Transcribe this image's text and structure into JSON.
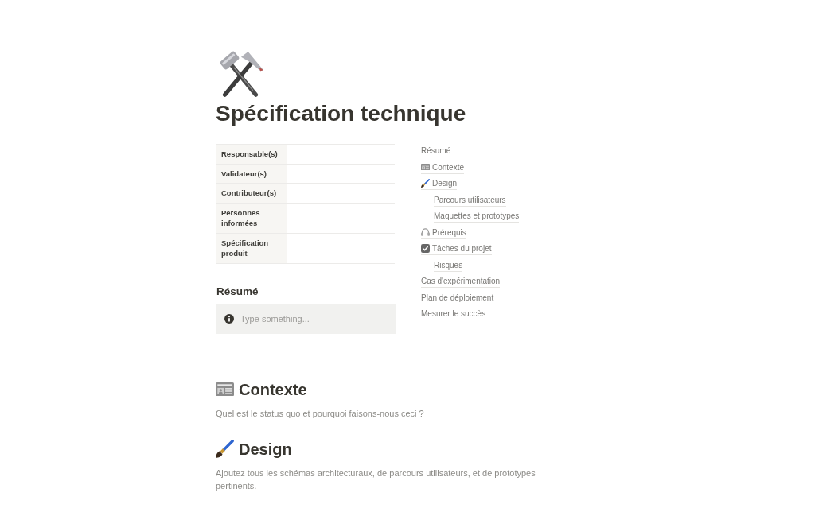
{
  "page": {
    "title": "Spécification technique"
  },
  "properties": [
    {
      "label": "Responsable(s)"
    },
    {
      "label": "Validateur(s)"
    },
    {
      "label": "Contributeur(s)"
    },
    {
      "label": "Personnes informées"
    },
    {
      "label": "Spécification produit"
    }
  ],
  "summary": {
    "heading": "Résumé",
    "callout": {
      "placeholder": "Type something..."
    }
  },
  "table_of_contents": [
    {
      "label": "Résumé"
    },
    {
      "label": "Contexte",
      "kind": "newspaper"
    },
    {
      "label": "Design",
      "kind": "brush",
      "children": [
        {
          "label": "Parcours utilisateurs"
        },
        {
          "label": "Maquettes et prototypes"
        }
      ]
    },
    {
      "label": "Prérequis",
      "kind": "headphones"
    },
    {
      "label": "Tâches du projet",
      "kind": "tickbox",
      "children": [
        {
          "label": "Risques"
        }
      ]
    },
    {
      "label": "Cas d'expérimentation"
    },
    {
      "label": "Plan de déploiement"
    },
    {
      "label": "Mesurer le succès"
    }
  ],
  "sections": [
    {
      "heading": "Contexte",
      "kind": "newspaper",
      "text": "Quel est le status quo et pourquoi faisons-nous ceci ?"
    },
    {
      "heading": "Design",
      "kind": "brush",
      "text": "Ajoutez tous les schémas architecturaux, de parcours utilisateurs, et de prototypes pertinents."
    }
  ]
}
